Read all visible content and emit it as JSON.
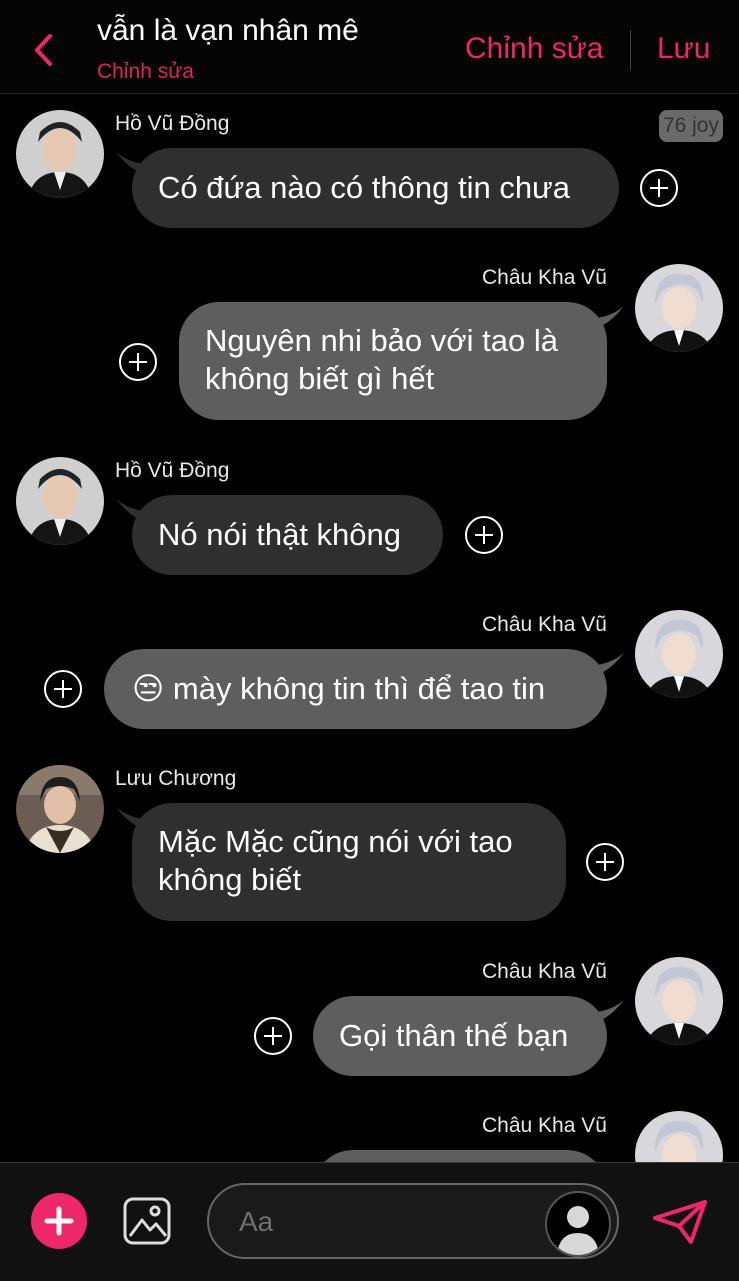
{
  "header": {
    "title": "vẫn là vạn nhân mê",
    "subtitle": "Chỉnh sửa",
    "edit_label": "Chỉnh sửa",
    "save_label": "Lưu",
    "accent": "#f0266a"
  },
  "joy_badge": "76 joy",
  "messages": [
    {
      "sender": "Hồ Vũ Đồng",
      "side": "left",
      "text": "Có đứa nào có thông tin chưa"
    },
    {
      "sender": "Châu Kha Vũ",
      "side": "right",
      "text": "Nguyên nhi bảo với tao là\nkhông biết gì hết"
    },
    {
      "sender": "Hồ Vũ Đồng",
      "side": "left",
      "text": "Nó nói thật không"
    },
    {
      "sender": "Châu Kha Vũ",
      "side": "right",
      "text": "😒 mày không tin thì để tao tin"
    },
    {
      "sender": "Lưu Chương",
      "side": "left",
      "text": "Mặc Mặc cũng nói với tao\nkhông biết"
    },
    {
      "sender": "Châu Kha Vũ",
      "side": "right",
      "text": "Gọi thân thế bạn"
    },
    {
      "sender": "Châu Kha Vũ",
      "side": "right",
      "text": ""
    }
  ],
  "composer": {
    "placeholder": "Aa"
  },
  "icons": [
    "back-chevron-icon",
    "plus-circle-icon",
    "add-icon",
    "image-icon",
    "person-silhouette-icon",
    "send-icon"
  ]
}
